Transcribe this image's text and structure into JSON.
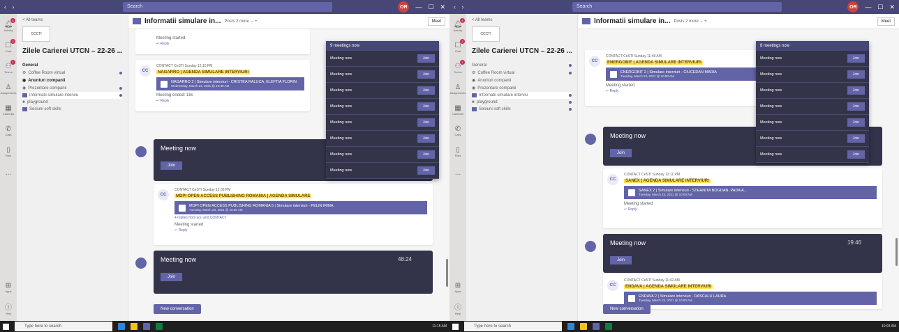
{
  "left": {
    "search_placeholder": "Search",
    "avatar": "OR",
    "rail": [
      {
        "label": "Activity",
        "icon": "bell-icon",
        "badge": "4"
      },
      {
        "label": "Chat",
        "icon": "chat-icon",
        "badge": "2"
      },
      {
        "label": "Teams",
        "icon": "teams-icon",
        "badge": "1"
      },
      {
        "label": "Assignments",
        "icon": "assignment-icon",
        "badge": ""
      },
      {
        "label": "Calendar",
        "icon": "calendar-icon",
        "badge": ""
      },
      {
        "label": "Calls",
        "icon": "phone-icon",
        "badge": ""
      },
      {
        "label": "Files",
        "icon": "file-icon",
        "badge": ""
      },
      {
        "label": "...",
        "icon": "more-icon",
        "badge": ""
      }
    ],
    "rail_bottom": [
      {
        "label": "Apps",
        "icon": "apps-icon"
      },
      {
        "label": "Help",
        "icon": "help-icon"
      }
    ],
    "sidebar": {
      "back": "< All teams",
      "logo": "CCCTI",
      "team_name": "Zilele Carierei UTCN – 22-26 ...",
      "channels": [
        {
          "label": "General",
          "style": "bold"
        },
        {
          "label": "Coffee Room virtual",
          "style": "normal"
        },
        {
          "label": "Anunturi companii",
          "style": "bold"
        },
        {
          "label": "Prezentare companii",
          "style": "normal"
        },
        {
          "label": "Informatii simulare interviu",
          "style": "sel"
        },
        {
          "label": "playground",
          "style": "normal"
        },
        {
          "label": "Sesiuni soft skills",
          "style": "normal"
        }
      ]
    },
    "channel_header": {
      "title": "Informatii simulare in...",
      "tabs": "Posts   2 more ⌄   +",
      "meet": "Meet"
    },
    "posts": [
      {
        "system": "Meeting started",
        "reply": "↵ Reply"
      },
      {
        "avatar": "CC",
        "author": "CONTACT CeSTI  Sunday 12:10 PM",
        "headline": "NAGARRO | AGENDA SIMULARE INTERVIURI",
        "card": "NAGARRO 2 | Simulare interviuri - CRISTEA RALUCA, ELEFTIA FLORIN",
        "card_sub": "Wednesday, March 24, 2021 @ 10:30 AM",
        "system": "Meeting ended: 18s",
        "reply": "↵ Reply"
      },
      {
        "avatar": "CC",
        "author": "CONTACT CeSTI  Sunday 12:03 PM",
        "headline": "MDPI OPEN ACCESS PUBLISHING ROMANIA | AGENDA SIMULARE",
        "card": "MDPI OPEN ACCESS PUBLISHING ROMANIA 5 | Simulare interviuri - PELIN IRINA",
        "card_sub": "Tuesday, March 23, 2021 @ 10:00 AM",
        "replies": "4 replies from you and CONTACT",
        "system": "Meeting started",
        "reply": "↵ Reply"
      }
    ],
    "meetings": [
      {
        "title": "Meeting now",
        "join": "Join",
        "time": ""
      },
      {
        "title": "Meeting now",
        "join": "Join",
        "time": "48:24"
      }
    ],
    "new_conversation": "New conversation",
    "panel": {
      "head": "9 meetings now",
      "rows": [
        "Meeting now",
        "Meeting now",
        "Meeting now",
        "Meeting now",
        "Meeting now",
        "Meeting now",
        "Meeting now",
        "Meeting now"
      ],
      "join": "Join"
    }
  },
  "right": {
    "search_placeholder": "Search",
    "avatar": "OR",
    "sidebar": {
      "back": "< All teams",
      "logo": "CCCTI",
      "team_name": "Zilele Carierei UTCN – 22-26 ...",
      "channels": [
        {
          "label": "General",
          "style": "normal"
        },
        {
          "label": "Coffee Room virtual",
          "style": "normal"
        },
        {
          "label": "Anunturi companii",
          "style": "normal"
        },
        {
          "label": "Prezentare companii",
          "style": "normal"
        },
        {
          "label": "Informatii simulare interviu",
          "style": "sel"
        },
        {
          "label": "playground",
          "style": "normal"
        },
        {
          "label": "Sesiuni soft skills",
          "style": "normal"
        }
      ]
    },
    "channel_header": {
      "title": "Informatii simulare in...",
      "tabs": "Posts   2 more ⌄   +",
      "meet": "Meet"
    },
    "posts": [
      {
        "avatar": "CC",
        "author": "CONTACT CeSTI  Sunday 11:48 AM",
        "headline": "ENERGOBIT | AGENDA SIMULARE INTERVIURI",
        "card": "ENERGOBIT 2 | Simulare interviuri - CIUCEDAN MARIA",
        "card_sub": "Tuesday, March 23, 2021 @ 10:00 AM",
        "system": "Meeting started",
        "reply": "↵ Reply"
      },
      {
        "avatar": "CC",
        "author": "CONTACT CeSTI  Sunday 12:11 PM",
        "headline": "SANEX | AGENDA SIMULARE INTERVIURI",
        "card": "SANEX 2 | Simulare interviuri - STEHNITA BOGDAN, PADA A...",
        "card_sub": "Tuesday, March 23, 2021 @ 10:00 AM",
        "system": "Meeting started",
        "reply": "↵ Reply"
      },
      {
        "avatar": "CC",
        "author": "CONTACT CeSTI  Sunday 11:42 AM",
        "headline": "ENDAVA | AGENDA SIMULARE INTERVIURI",
        "card": "ENDAVA 2 | Simulare interviuri - DASCALU LAURA",
        "card_sub": "Tuesday, March 23, 2021 @ 10:00 AM",
        "system": "",
        "reply": ""
      }
    ],
    "meetings": [
      {
        "title": "Meeting now",
        "join": "Join",
        "time": ""
      },
      {
        "title": "Meeting now",
        "join": "Join",
        "time": "19:46"
      }
    ],
    "new_conversation": "New conversation",
    "panel": {
      "head": "8 meetings now",
      "rows": [
        "Meeting now",
        "Meeting now",
        "Meeting now",
        "Meeting now",
        "Meeting now",
        "Meeting now",
        "Meeting now"
      ],
      "join": "Join"
    }
  },
  "taskbar": {
    "search": "Type here to search",
    "tray_left": "11:15 AM",
    "tray_right": "10:03 AM"
  }
}
